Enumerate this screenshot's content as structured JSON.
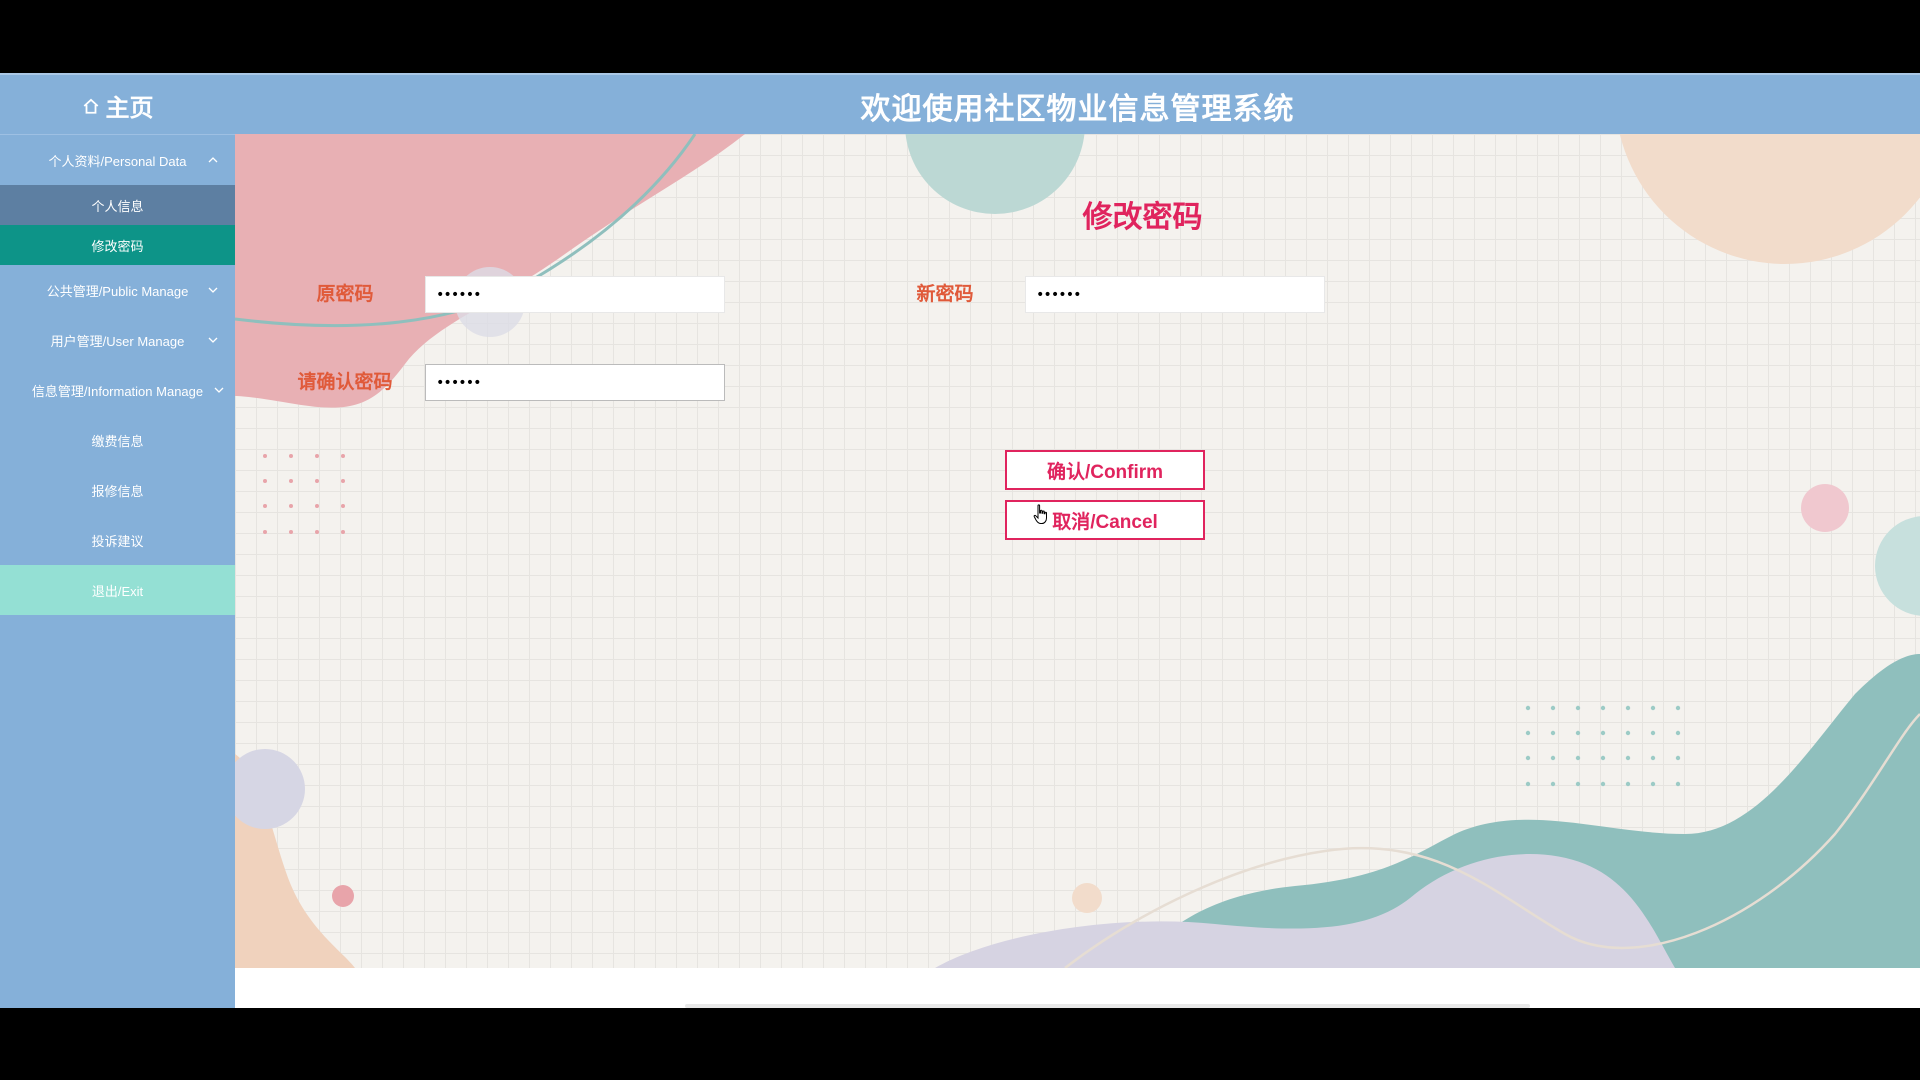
{
  "header": {
    "home_label": "主页",
    "title": "欢迎使用社区物业信息管理系统"
  },
  "sidebar": {
    "items": [
      {
        "label": "个人资料/Personal Data",
        "expanded": true,
        "children": [
          {
            "label": "个人信息",
            "active": false
          },
          {
            "label": "修改密码",
            "active": true
          }
        ]
      },
      {
        "label": "公共管理/Public Manage",
        "expanded": false
      },
      {
        "label": "用户管理/User Manage",
        "expanded": false
      },
      {
        "label": "信息管理/Information Manage",
        "expanded": false
      },
      {
        "label": "缴费信息"
      },
      {
        "label": "报修信息"
      },
      {
        "label": "投诉建议"
      },
      {
        "label": "退出/Exit"
      }
    ]
  },
  "form": {
    "heading": "修改密码",
    "old_password": {
      "label": "原密码",
      "value": "••••••"
    },
    "new_password": {
      "label": "新密码",
      "value": "••••••"
    },
    "confirm_password": {
      "label": "请确认密码",
      "value": "••••••"
    },
    "confirm_button": "确认/Confirm",
    "cancel_button": "取消/Cancel"
  },
  "colors": {
    "header_bg": "#85b0d9",
    "active_item": "#0d9488",
    "exit_bg": "#94e0d4",
    "accent": "#e0245e",
    "label": "#e05a3a"
  }
}
